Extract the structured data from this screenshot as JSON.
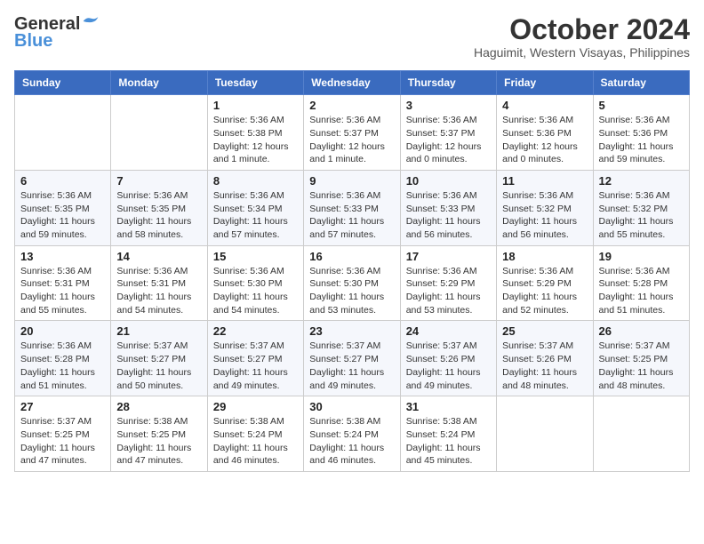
{
  "header": {
    "logo_line1": "General",
    "logo_line2": "Blue",
    "month": "October 2024",
    "location": "Haguimit, Western Visayas, Philippines"
  },
  "weekdays": [
    "Sunday",
    "Monday",
    "Tuesday",
    "Wednesday",
    "Thursday",
    "Friday",
    "Saturday"
  ],
  "weeks": [
    [
      {
        "day": "",
        "info": ""
      },
      {
        "day": "",
        "info": ""
      },
      {
        "day": "1",
        "info": "Sunrise: 5:36 AM\nSunset: 5:38 PM\nDaylight: 12 hours\nand 1 minute."
      },
      {
        "day": "2",
        "info": "Sunrise: 5:36 AM\nSunset: 5:37 PM\nDaylight: 12 hours\nand 1 minute."
      },
      {
        "day": "3",
        "info": "Sunrise: 5:36 AM\nSunset: 5:37 PM\nDaylight: 12 hours\nand 0 minutes."
      },
      {
        "day": "4",
        "info": "Sunrise: 5:36 AM\nSunset: 5:36 PM\nDaylight: 12 hours\nand 0 minutes."
      },
      {
        "day": "5",
        "info": "Sunrise: 5:36 AM\nSunset: 5:36 PM\nDaylight: 11 hours\nand 59 minutes."
      }
    ],
    [
      {
        "day": "6",
        "info": "Sunrise: 5:36 AM\nSunset: 5:35 PM\nDaylight: 11 hours\nand 59 minutes."
      },
      {
        "day": "7",
        "info": "Sunrise: 5:36 AM\nSunset: 5:35 PM\nDaylight: 11 hours\nand 58 minutes."
      },
      {
        "day": "8",
        "info": "Sunrise: 5:36 AM\nSunset: 5:34 PM\nDaylight: 11 hours\nand 57 minutes."
      },
      {
        "day": "9",
        "info": "Sunrise: 5:36 AM\nSunset: 5:33 PM\nDaylight: 11 hours\nand 57 minutes."
      },
      {
        "day": "10",
        "info": "Sunrise: 5:36 AM\nSunset: 5:33 PM\nDaylight: 11 hours\nand 56 minutes."
      },
      {
        "day": "11",
        "info": "Sunrise: 5:36 AM\nSunset: 5:32 PM\nDaylight: 11 hours\nand 56 minutes."
      },
      {
        "day": "12",
        "info": "Sunrise: 5:36 AM\nSunset: 5:32 PM\nDaylight: 11 hours\nand 55 minutes."
      }
    ],
    [
      {
        "day": "13",
        "info": "Sunrise: 5:36 AM\nSunset: 5:31 PM\nDaylight: 11 hours\nand 55 minutes."
      },
      {
        "day": "14",
        "info": "Sunrise: 5:36 AM\nSunset: 5:31 PM\nDaylight: 11 hours\nand 54 minutes."
      },
      {
        "day": "15",
        "info": "Sunrise: 5:36 AM\nSunset: 5:30 PM\nDaylight: 11 hours\nand 54 minutes."
      },
      {
        "day": "16",
        "info": "Sunrise: 5:36 AM\nSunset: 5:30 PM\nDaylight: 11 hours\nand 53 minutes."
      },
      {
        "day": "17",
        "info": "Sunrise: 5:36 AM\nSunset: 5:29 PM\nDaylight: 11 hours\nand 53 minutes."
      },
      {
        "day": "18",
        "info": "Sunrise: 5:36 AM\nSunset: 5:29 PM\nDaylight: 11 hours\nand 52 minutes."
      },
      {
        "day": "19",
        "info": "Sunrise: 5:36 AM\nSunset: 5:28 PM\nDaylight: 11 hours\nand 51 minutes."
      }
    ],
    [
      {
        "day": "20",
        "info": "Sunrise: 5:36 AM\nSunset: 5:28 PM\nDaylight: 11 hours\nand 51 minutes."
      },
      {
        "day": "21",
        "info": "Sunrise: 5:37 AM\nSunset: 5:27 PM\nDaylight: 11 hours\nand 50 minutes."
      },
      {
        "day": "22",
        "info": "Sunrise: 5:37 AM\nSunset: 5:27 PM\nDaylight: 11 hours\nand 49 minutes."
      },
      {
        "day": "23",
        "info": "Sunrise: 5:37 AM\nSunset: 5:27 PM\nDaylight: 11 hours\nand 49 minutes."
      },
      {
        "day": "24",
        "info": "Sunrise: 5:37 AM\nSunset: 5:26 PM\nDaylight: 11 hours\nand 49 minutes."
      },
      {
        "day": "25",
        "info": "Sunrise: 5:37 AM\nSunset: 5:26 PM\nDaylight: 11 hours\nand 48 minutes."
      },
      {
        "day": "26",
        "info": "Sunrise: 5:37 AM\nSunset: 5:25 PM\nDaylight: 11 hours\nand 48 minutes."
      }
    ],
    [
      {
        "day": "27",
        "info": "Sunrise: 5:37 AM\nSunset: 5:25 PM\nDaylight: 11 hours\nand 47 minutes."
      },
      {
        "day": "28",
        "info": "Sunrise: 5:38 AM\nSunset: 5:25 PM\nDaylight: 11 hours\nand 47 minutes."
      },
      {
        "day": "29",
        "info": "Sunrise: 5:38 AM\nSunset: 5:24 PM\nDaylight: 11 hours\nand 46 minutes."
      },
      {
        "day": "30",
        "info": "Sunrise: 5:38 AM\nSunset: 5:24 PM\nDaylight: 11 hours\nand 46 minutes."
      },
      {
        "day": "31",
        "info": "Sunrise: 5:38 AM\nSunset: 5:24 PM\nDaylight: 11 hours\nand 45 minutes."
      },
      {
        "day": "",
        "info": ""
      },
      {
        "day": "",
        "info": ""
      }
    ]
  ]
}
